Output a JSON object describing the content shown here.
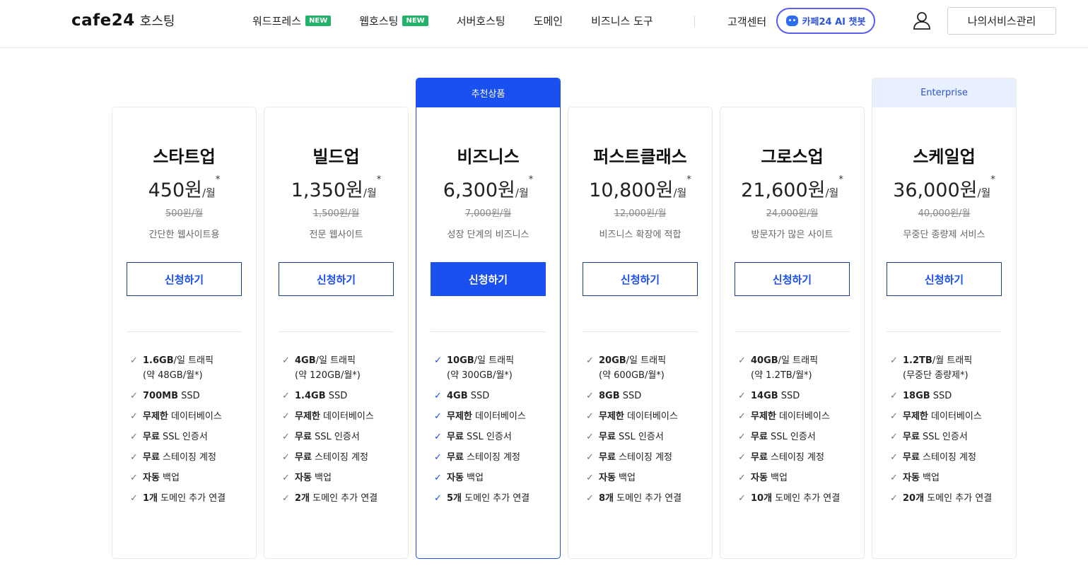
{
  "header": {
    "logo": "cafe24",
    "logo_sub": "호스팅",
    "nav": [
      {
        "label": "워드프레스",
        "badge": "NEW"
      },
      {
        "label": "웹호스팅",
        "badge": "NEW"
      },
      {
        "label": "서버호스팅",
        "badge": ""
      },
      {
        "label": "도메인",
        "badge": ""
      },
      {
        "label": "비즈니스 도구",
        "badge": ""
      }
    ],
    "support": "고객센터",
    "ai_button": "카페24 AI 챗봇",
    "my_service": "나의서비스관리"
  },
  "apply_label": "신청하기",
  "plans": [
    {
      "name": "스타트업",
      "price": "450원",
      "per": "/월",
      "star": "*",
      "original": "500원/월",
      "desc": "간단한 웹사이트용",
      "features": [
        [
          "1.6GB",
          "/일 트래픽"
        ],
        [
          "",
          "(약 48GB/월*)"
        ],
        [
          "700MB",
          " SSD"
        ],
        [
          "무제한",
          " 데이터베이스"
        ],
        [
          "무료",
          " SSL 인증서"
        ],
        [
          "무료",
          " 스테이징 계정"
        ],
        [
          "자동",
          " 백업"
        ],
        [
          "1개",
          " 도메인 추가 연결"
        ]
      ]
    },
    {
      "name": "빌드업",
      "price": "1,350원",
      "per": "/월",
      "star": "*",
      "original": "1,500원/월",
      "desc": "전문 웹사이트",
      "features": [
        [
          "4GB",
          "/일 트래픽"
        ],
        [
          "",
          "(약 120GB/월*)"
        ],
        [
          "1.4GB",
          " SSD"
        ],
        [
          "무제한",
          " 데이터베이스"
        ],
        [
          "무료",
          " SSL 인증서"
        ],
        [
          "무료",
          " 스테이징 계정"
        ],
        [
          "자동",
          " 백업"
        ],
        [
          "2개",
          " 도메인 추가 연결"
        ]
      ]
    },
    {
      "name": "비즈니스",
      "price": "6,300원",
      "per": "/월",
      "star": "*",
      "original": "7,000원/월",
      "desc": "성장 단계의 비즈니스",
      "ribbon": "추천상품",
      "features": [
        [
          "10GB",
          "/일 트래픽"
        ],
        [
          "",
          "(약 300GB/월*)"
        ],
        [
          "4GB",
          " SSD"
        ],
        [
          "무제한",
          " 데이터베이스"
        ],
        [
          "무료",
          " SSL 인증서"
        ],
        [
          "무료",
          " 스테이징 계정"
        ],
        [
          "자동",
          " 백업"
        ],
        [
          "5개",
          " 도메인 추가 연결"
        ]
      ]
    },
    {
      "name": "퍼스트클래스",
      "price": "10,800원",
      "per": "/월",
      "star": "*",
      "original": "12,000원/월",
      "desc": "비즈니스 확장에 적합",
      "features": [
        [
          "20GB",
          "/일 트래픽"
        ],
        [
          "",
          "(약 600GB/월*)"
        ],
        [
          "8GB",
          " SSD"
        ],
        [
          "무제한",
          " 데이터베이스"
        ],
        [
          "무료",
          " SSL 인증서"
        ],
        [
          "무료",
          " 스테이징 계정"
        ],
        [
          "자동",
          " 백업"
        ],
        [
          "8개",
          " 도메인 추가 연결"
        ]
      ]
    },
    {
      "name": "그로스업",
      "price": "21,600원",
      "per": "/월",
      "star": "*",
      "original": "24,000원/월",
      "desc": "방문자가 많은 사이트",
      "features": [
        [
          "40GB",
          "/일 트래픽"
        ],
        [
          "",
          "(약 1.2TB/월*)"
        ],
        [
          "14GB",
          " SSD"
        ],
        [
          "무제한",
          " 데이터베이스"
        ],
        [
          "무료",
          " SSL 인증서"
        ],
        [
          "무료",
          " 스테이징 계정"
        ],
        [
          "자동",
          " 백업"
        ],
        [
          "10개",
          " 도메인 추가 연결"
        ]
      ]
    },
    {
      "name": "스케일업",
      "price": "36,000원",
      "per": "/월",
      "star": "*",
      "original": "40,000원/월",
      "desc": "무중단 종량제 서비스",
      "ribbon": "Enterprise",
      "features": [
        [
          "1.2TB",
          "/월 트래픽"
        ],
        [
          "",
          "(무중단 종량제*)"
        ],
        [
          "18GB",
          " SSD"
        ],
        [
          "무제한",
          " 데이터베이스"
        ],
        [
          "무료",
          " SSL 인증서"
        ],
        [
          "무료",
          " 스테이징 계정"
        ],
        [
          "자동",
          " 백업"
        ],
        [
          "20개",
          " 도메인 추가 연결"
        ]
      ]
    }
  ],
  "colors": {
    "accent": "#1a4ff0",
    "new_badge": "#23b26a",
    "enterprise_bg": "#e8efff"
  }
}
